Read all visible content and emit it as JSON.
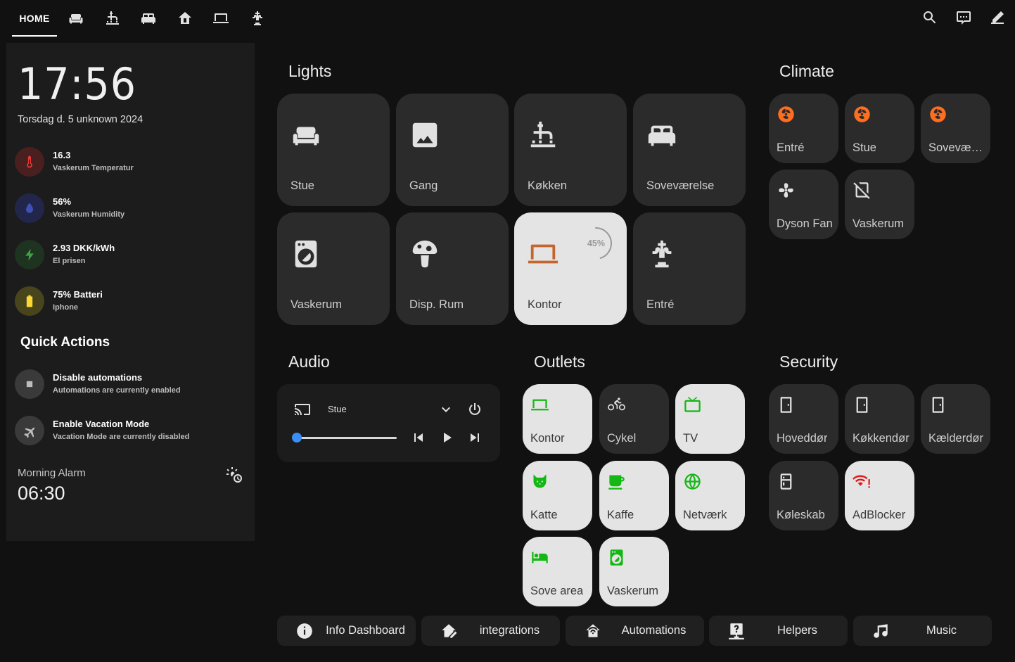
{
  "colors": {
    "background": "#111111",
    "panel": "#1c1c1c",
    "tile": "#2b2b2b",
    "tile_on": "#e4e4e4",
    "orange": "#ff6d1f",
    "green": "#14b814",
    "accent": "#3b8ef5",
    "danger": "#e11a1a"
  },
  "topbar": {
    "home_label": "HOME",
    "view_icons": [
      "sofa-icon",
      "faucet-icon",
      "bed-icon",
      "home-icon",
      "laptop-icon",
      "outdoor-light-icon"
    ],
    "action_icons": [
      "search-icon",
      "assist-icon",
      "edit-icon"
    ]
  },
  "left": {
    "clock": "17:56",
    "date": "Torsdag d. 5 unknown 2024",
    "sensors": [
      {
        "value": "16.3",
        "label": "Vaskerum Temperatur",
        "icon": "thermometer-icon",
        "color": "#e53935"
      },
      {
        "value": "56%",
        "label": "Vaskerum Humidity",
        "icon": "water-icon",
        "color": "#3f51b5"
      },
      {
        "value": "2.93 DKK/kWh",
        "label": "El prisen",
        "icon": "flash-icon",
        "color": "#2e7d32"
      },
      {
        "value": "75% Batteri",
        "label": "Iphone",
        "icon": "battery-icon",
        "color": "#fdd835"
      }
    ],
    "quick_actions_title": "Quick Actions",
    "quick_actions": [
      {
        "title": "Disable automations",
        "subtitle": "Automations are currently enabled",
        "icon": "stop-icon"
      },
      {
        "title": "Enable Vacation Mode",
        "subtitle": "Vacation Mode are currently disabled",
        "icon": "airplane-icon"
      }
    ],
    "alarm_label": "Morning Alarm",
    "alarm_time": "06:30"
  },
  "lights": {
    "title": "Lights",
    "tiles": [
      {
        "name": "Stue",
        "icon": "sofa-icon",
        "on": false
      },
      {
        "name": "Gang",
        "icon": "image-icon",
        "on": false
      },
      {
        "name": "Køkken",
        "icon": "faucet-icon",
        "on": false
      },
      {
        "name": "Soveværelse",
        "icon": "bed-icon",
        "on": false
      },
      {
        "name": "Vaskerum",
        "icon": "washing-machine-icon",
        "on": false
      },
      {
        "name": "Disp. Rum",
        "icon": "mushroom-icon",
        "on": false
      },
      {
        "name": "Kontor",
        "icon": "laptop-icon",
        "on": true,
        "brightness": "45%"
      },
      {
        "name": "Entré",
        "icon": "outdoor-light-icon",
        "on": false
      }
    ]
  },
  "climate": {
    "title": "Climate",
    "tiles": [
      {
        "name": "Entré",
        "icon": "heat-pump-icon"
      },
      {
        "name": "Stue",
        "icon": "heat-pump-icon"
      },
      {
        "name": "Soveværelse",
        "icon": "heat-pump-icon"
      },
      {
        "name": "Dyson Fan",
        "icon": "fan-icon"
      },
      {
        "name": "Vaskerum",
        "icon": "dehumidifier-off-icon"
      }
    ]
  },
  "audio": {
    "title": "Audio",
    "source": "Stue",
    "volume": 0.0
  },
  "outlets": {
    "title": "Outlets",
    "tiles": [
      {
        "name": "Kontor",
        "icon": "laptop-icon",
        "on": true
      },
      {
        "name": "Cykel",
        "icon": "bike-icon",
        "on": false
      },
      {
        "name": "TV",
        "icon": "tv-icon",
        "on": true
      },
      {
        "name": "Katte",
        "icon": "cat-icon",
        "on": true
      },
      {
        "name": "Kaffe",
        "icon": "coffee-icon",
        "on": true
      },
      {
        "name": "Netværk",
        "icon": "web-icon",
        "on": true
      },
      {
        "name": "Sove area",
        "icon": "bed-icon",
        "on": true
      },
      {
        "name": "Vaskerum",
        "icon": "washing-machine-icon",
        "on": true
      }
    ]
  },
  "security": {
    "title": "Security",
    "tiles": [
      {
        "name": "Hoveddør",
        "icon": "door-icon",
        "on": false
      },
      {
        "name": "Køkkendør",
        "icon": "door-icon",
        "on": false
      },
      {
        "name": "Kælderdør",
        "icon": "door-icon",
        "on": false
      },
      {
        "name": "Køleskab",
        "icon": "fridge-icon",
        "on": false
      },
      {
        "name": "AdBlocker",
        "icon": "wifi-alert-icon",
        "on": true
      }
    ]
  },
  "bottom_buttons": [
    {
      "label": "Info Dashboard",
      "icon": "info-icon"
    },
    {
      "label": "integrations",
      "icon": "home-edit-icon"
    },
    {
      "label": "Automations",
      "icon": "home-automation-icon"
    },
    {
      "label": "Helpers",
      "icon": "help-network-icon"
    },
    {
      "label": "Music",
      "icon": "music-icon"
    }
  ]
}
